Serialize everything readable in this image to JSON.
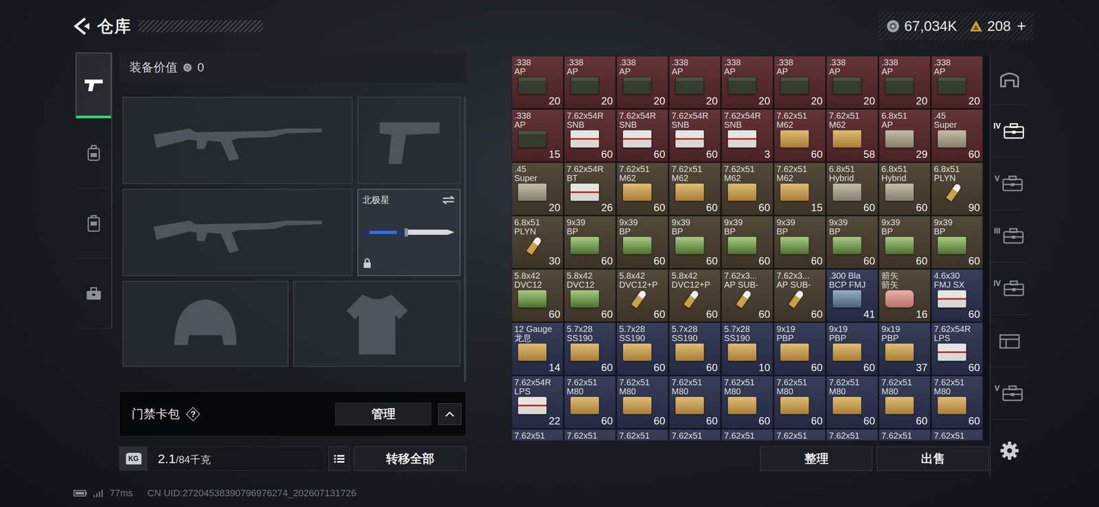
{
  "header": {
    "title": "仓库"
  },
  "currency": {
    "coins": {
      "amount": "67,034K"
    },
    "gold": {
      "amount": "208",
      "add": "+"
    }
  },
  "sidebar": {
    "items": [
      {
        "kind": "weapon",
        "selected": true
      },
      {
        "kind": "rig",
        "selected": false
      },
      {
        "kind": "bag",
        "selected": false
      },
      {
        "kind": "tools",
        "selected": false
      }
    ]
  },
  "equipment": {
    "title": "装备价值",
    "value": "0",
    "slots": [
      {
        "kind": "rifle"
      },
      {
        "kind": "pistol"
      },
      {
        "kind": "rifle"
      },
      {
        "kind": "melee",
        "label": "北极星",
        "locked": true
      },
      {
        "kind": "helmet"
      },
      {
        "kind": "armor"
      }
    ]
  },
  "keycard": {
    "label": "门禁卡包",
    "help": "?",
    "button": "管理",
    "expanded": false
  },
  "footer": {
    "weight_icon": "KG",
    "weight": "2.1",
    "capacity": "/84千克",
    "transfer": "转移全部"
  },
  "grid": {
    "items": [
      {
        "name": ".338",
        "sub": "AP",
        "count": "20",
        "color": "#5a2a2d",
        "pack": "can"
      },
      {
        "name": ".338",
        "sub": "AP",
        "count": "20",
        "color": "#5a2a2d",
        "pack": "can"
      },
      {
        "name": ".338",
        "sub": "AP",
        "count": "20",
        "color": "#5a2a2d",
        "pack": "can"
      },
      {
        "name": ".338",
        "sub": "AP",
        "count": "20",
        "color": "#5a2a2d",
        "pack": "can"
      },
      {
        "name": ".338",
        "sub": "AP",
        "count": "20",
        "color": "#5a2a2d",
        "pack": "can"
      },
      {
        "name": ".338",
        "sub": "AP",
        "count": "20",
        "color": "#5a2a2d",
        "pack": "can"
      },
      {
        "name": ".338",
        "sub": "AP",
        "count": "20",
        "color": "#5a2a2d",
        "pack": "can"
      },
      {
        "name": ".338",
        "sub": "AP",
        "count": "20",
        "color": "#5a2a2d",
        "pack": "can"
      },
      {
        "name": ".338",
        "sub": "AP",
        "count": "20",
        "color": "#5a2a2d",
        "pack": "can"
      },
      {
        "name": ".338",
        "sub": "AP",
        "count": "15",
        "color": "#5a2a2d",
        "pack": "can"
      },
      {
        "name": "7.62x54R",
        "sub": "SNB",
        "count": "60",
        "color": "#5a2a2d",
        "pack": "white"
      },
      {
        "name": "7.62x54R",
        "sub": "SNB",
        "count": "60",
        "color": "#5a2a2d",
        "pack": "white"
      },
      {
        "name": "7.62x54R",
        "sub": "SNB",
        "count": "60",
        "color": "#5a2a2d",
        "pack": "white"
      },
      {
        "name": "7.62x54R",
        "sub": "SNB",
        "count": "3",
        "color": "#5a2a2d",
        "pack": "white"
      },
      {
        "name": "7.62x51",
        "sub": "M62",
        "count": "60",
        "color": "#5a2a2d",
        "pack": "tan"
      },
      {
        "name": "7.62x51",
        "sub": "M62",
        "count": "58",
        "color": "#5a2a2d",
        "pack": "tan"
      },
      {
        "name": "6.8x51",
        "sub": "AP",
        "count": "29",
        "color": "#5a2a2d",
        "pack": "gray"
      },
      {
        "name": ".45",
        "sub": "Super",
        "count": "60",
        "color": "#5a2a2d",
        "pack": "gray"
      },
      {
        "name": ".45",
        "sub": "Super",
        "count": "20",
        "color": "#4a3f30",
        "pack": "gray"
      },
      {
        "name": "7.62x54R",
        "sub": "BT",
        "count": "26",
        "color": "#4a3f30",
        "pack": "white"
      },
      {
        "name": "7.62x51",
        "sub": "M62",
        "count": "60",
        "color": "#4a3f30",
        "pack": "tan"
      },
      {
        "name": "7.62x51",
        "sub": "M62",
        "count": "60",
        "color": "#4a3f30",
        "pack": "tan"
      },
      {
        "name": "7.62x51",
        "sub": "M62",
        "count": "60",
        "color": "#4a3f30",
        "pack": "tan"
      },
      {
        "name": "7.62x51",
        "sub": "M62",
        "count": "15",
        "color": "#4a3f30",
        "pack": "tan"
      },
      {
        "name": "6.8x51",
        "sub": "Hybrid",
        "count": "60",
        "color": "#4a3f30",
        "pack": "gray"
      },
      {
        "name": "6.8x51",
        "sub": "Hybrid",
        "count": "60",
        "color": "#4a3f30",
        "pack": "gray"
      },
      {
        "name": "6.8x51",
        "sub": "PLYN",
        "count": "90",
        "color": "#4a3f30",
        "pack": "bullet"
      },
      {
        "name": "6.8x51",
        "sub": "PLYN",
        "count": "30",
        "color": "#4a3f30",
        "pack": "bullet"
      },
      {
        "name": "9x39",
        "sub": "BP",
        "count": "60",
        "color": "#4a3f30",
        "pack": "green"
      },
      {
        "name": "9x39",
        "sub": "BP",
        "count": "60",
        "color": "#4a3f30",
        "pack": "green"
      },
      {
        "name": "9x39",
        "sub": "BP",
        "count": "60",
        "color": "#4a3f30",
        "pack": "green"
      },
      {
        "name": "9x39",
        "sub": "BP",
        "count": "60",
        "color": "#4a3f30",
        "pack": "green"
      },
      {
        "name": "9x39",
        "sub": "BP",
        "count": "60",
        "color": "#4a3f30",
        "pack": "green"
      },
      {
        "name": "9x39",
        "sub": "BP",
        "count": "60",
        "color": "#4a3f30",
        "pack": "green"
      },
      {
        "name": "9x39",
        "sub": "BP",
        "count": "60",
        "color": "#4a3f30",
        "pack": "green"
      },
      {
        "name": "9x39",
        "sub": "BP",
        "count": "60",
        "color": "#4a3f30",
        "pack": "green"
      },
      {
        "name": "5.8x42",
        "sub": "DVC12",
        "count": "60",
        "color": "#4a3f30",
        "pack": "green"
      },
      {
        "name": "5.8x42",
        "sub": "DVC12",
        "count": "60",
        "color": "#4a3f30",
        "pack": "green"
      },
      {
        "name": "5.8x42",
        "sub": "DVC12+P",
        "count": "60",
        "color": "#4a3f30",
        "pack": "bullet"
      },
      {
        "name": "5.8x42",
        "sub": "DVC12+P",
        "count": "60",
        "color": "#4a3f30",
        "pack": "bullet"
      },
      {
        "name": "7.62x3...",
        "sub": "AP SUB-",
        "count": "60",
        "color": "#4a3f30",
        "pack": "bullet"
      },
      {
        "name": "7.62x3...",
        "sub": "AP SUB-",
        "count": "60",
        "color": "#4a3f30",
        "pack": "bullet"
      },
      {
        "name": ".300 Bla",
        "sub": "BCP FMJ",
        "count": "41",
        "color": "#2d3350",
        "pack": "blue"
      },
      {
        "name": "箭矢",
        "sub": "箭矢",
        "count": "16",
        "color": "#4a3f30",
        "pack": "pink"
      },
      {
        "name": "4.6x30",
        "sub": "FMJ SX",
        "count": "60",
        "color": "#2d3350",
        "pack": "white"
      },
      {
        "name": "12 Gauge",
        "sub": "龙息",
        "count": "14",
        "color": "#2d3350",
        "pack": "tan"
      },
      {
        "name": "5.7x28",
        "sub": "SS190",
        "count": "60",
        "color": "#2d3350",
        "pack": "tan"
      },
      {
        "name": "5.7x28",
        "sub": "SS190",
        "count": "60",
        "color": "#2d3350",
        "pack": "tan"
      },
      {
        "name": "5.7x28",
        "sub": "SS190",
        "count": "60",
        "color": "#2d3350",
        "pack": "tan"
      },
      {
        "name": "5.7x28",
        "sub": "SS190",
        "count": "10",
        "color": "#2d3350",
        "pack": "tan"
      },
      {
        "name": "9x19",
        "sub": "PBP",
        "count": "60",
        "color": "#2d3350",
        "pack": "tan"
      },
      {
        "name": "9x19",
        "sub": "PBP",
        "count": "60",
        "color": "#2d3350",
        "pack": "tan"
      },
      {
        "name": "9x19",
        "sub": "PBP",
        "count": "37",
        "color": "#2d3350",
        "pack": "tan"
      },
      {
        "name": "7.62x54R",
        "sub": "LPS",
        "count": "60",
        "color": "#2d3350",
        "pack": "white"
      },
      {
        "name": "7.62x54R",
        "sub": "LPS",
        "count": "22",
        "color": "#2d3350",
        "pack": "white"
      },
      {
        "name": "7.62x51",
        "sub": "M80",
        "count": "60",
        "color": "#2d3350",
        "pack": "tan"
      },
      {
        "name": "7.62x51",
        "sub": "M80",
        "count": "60",
        "color": "#2d3350",
        "pack": "tan"
      },
      {
        "name": "7.62x51",
        "sub": "M80",
        "count": "60",
        "color": "#2d3350",
        "pack": "tan"
      },
      {
        "name": "7.62x51",
        "sub": "M80",
        "count": "60",
        "color": "#2d3350",
        "pack": "tan"
      },
      {
        "name": "7.62x51",
        "sub": "M80",
        "count": "60",
        "color": "#2d3350",
        "pack": "tan"
      },
      {
        "name": "7.62x51",
        "sub": "M80",
        "count": "60",
        "color": "#2d3350",
        "pack": "tan"
      },
      {
        "name": "7.62x51",
        "sub": "M80",
        "count": "60",
        "color": "#2d3350",
        "pack": "tan"
      },
      {
        "name": "7.62x51",
        "sub": "M80",
        "count": "60",
        "color": "#2d3350",
        "pack": "tan"
      },
      {
        "name": "7.62x51",
        "color": "#2d3350",
        "pack": "tan"
      },
      {
        "name": "7.62x51",
        "color": "#2d3350",
        "pack": "tan"
      },
      {
        "name": "7.62x51",
        "color": "#2d3350",
        "pack": "tan"
      },
      {
        "name": "7.62x51",
        "color": "#2d3350",
        "pack": "tan"
      },
      {
        "name": "7.62x51",
        "color": "#2d3350",
        "pack": "tan"
      },
      {
        "name": "7.62x51",
        "color": "#2d3350",
        "pack": "tan"
      },
      {
        "name": "7.62x51",
        "color": "#2d3350",
        "pack": "tan"
      },
      {
        "name": "7.62x51",
        "color": "#2d3350",
        "pack": "tan"
      },
      {
        "name": "7.62x51",
        "color": "#2d3350",
        "pack": "tan"
      }
    ]
  },
  "grid_buttons": [
    "整理",
    "出售"
  ],
  "categories": [
    {
      "kind": "home",
      "selected": false
    },
    {
      "kind": "case",
      "label": "IV",
      "selected": true
    },
    {
      "kind": "case",
      "label": "V",
      "selected": false
    },
    {
      "kind": "case",
      "label": "III",
      "selected": false
    },
    {
      "kind": "case",
      "label": "IV",
      "selected": false
    },
    {
      "kind": "crate",
      "selected": false
    },
    {
      "kind": "case",
      "label": "V",
      "selected": false
    }
  ],
  "status": {
    "ping": "77ms",
    "uid": "CN UID:27204538390796976274_202607131726"
  }
}
